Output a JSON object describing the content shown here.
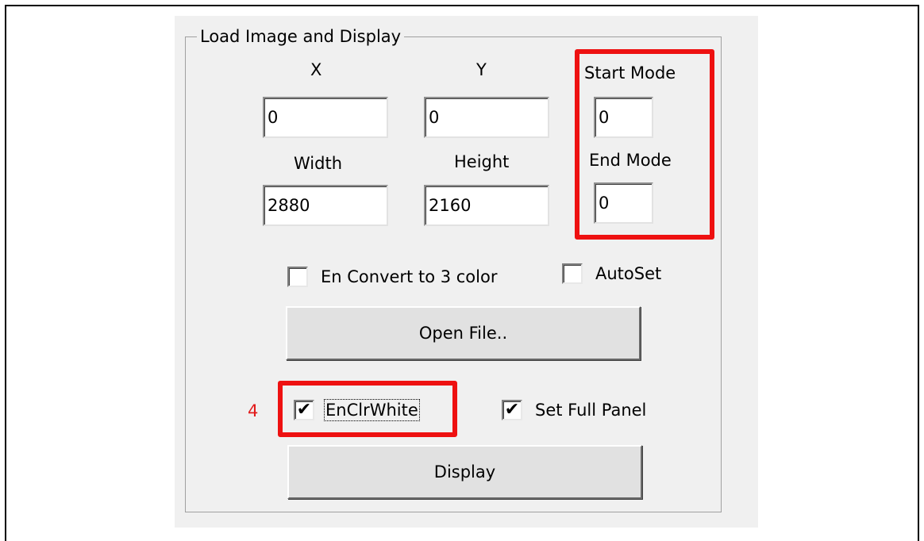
{
  "group": {
    "title": "Load Image and Display"
  },
  "fields": {
    "x": {
      "label": "X",
      "value": "0"
    },
    "y": {
      "label": "Y",
      "value": "0"
    },
    "start_mode": {
      "label": "Start Mode",
      "value": "0"
    },
    "width": {
      "label": "Width",
      "value": "2880"
    },
    "height": {
      "label": "Height",
      "value": "2160"
    },
    "end_mode": {
      "label": "End Mode",
      "value": "0"
    }
  },
  "checkboxes": {
    "convert_3_color": {
      "label": "En Convert to 3 color",
      "checked": false,
      "mark": ""
    },
    "autoset": {
      "label": "AutoSet",
      "checked": false,
      "mark": ""
    },
    "enclr_white": {
      "label": "EnClrWhite",
      "checked": true,
      "mark": "✔"
    },
    "set_full_panel": {
      "label": "Set Full Panel",
      "checked": true,
      "mark": "✔"
    }
  },
  "buttons": {
    "open_file": "Open File..",
    "display": "Display"
  },
  "annotation": {
    "step_number": "4"
  },
  "colors": {
    "highlight": "#ee1111",
    "annotation": "#e21b1b",
    "dialog_bg": "#f0f0f0"
  }
}
